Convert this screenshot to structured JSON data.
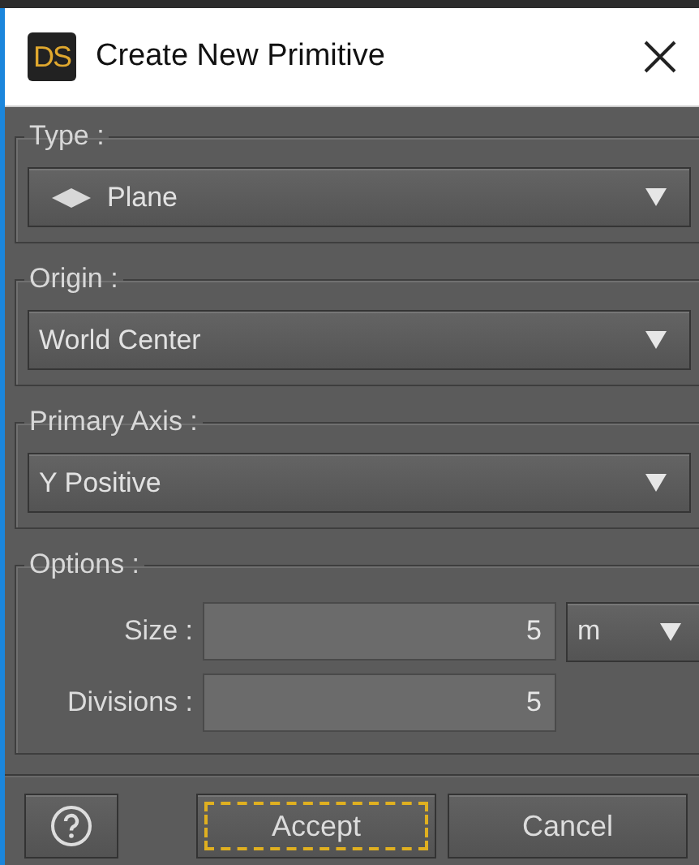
{
  "window": {
    "badge": "DS",
    "title": "Create New Primitive"
  },
  "groups": [
    {
      "label": "Type :",
      "kind": "dropdown",
      "value": "Plane",
      "has_icon": true
    },
    {
      "label": "Origin :",
      "kind": "dropdown",
      "value": "World Center",
      "has_icon": false
    },
    {
      "label": "Primary Axis :",
      "kind": "dropdown",
      "value": "Y Positive",
      "has_icon": false
    },
    {
      "label": "Options :",
      "kind": "fields",
      "fields": [
        {
          "label": "Size :",
          "value": "5",
          "unit": "m"
        },
        {
          "label": "Divisions :",
          "value": "5"
        }
      ]
    }
  ],
  "buttons": [
    {
      "kind": "help",
      "focused": false
    },
    {
      "kind": "text",
      "label": "Accept",
      "focused": true
    },
    {
      "kind": "text",
      "label": "Cancel",
      "focused": false
    }
  ]
}
